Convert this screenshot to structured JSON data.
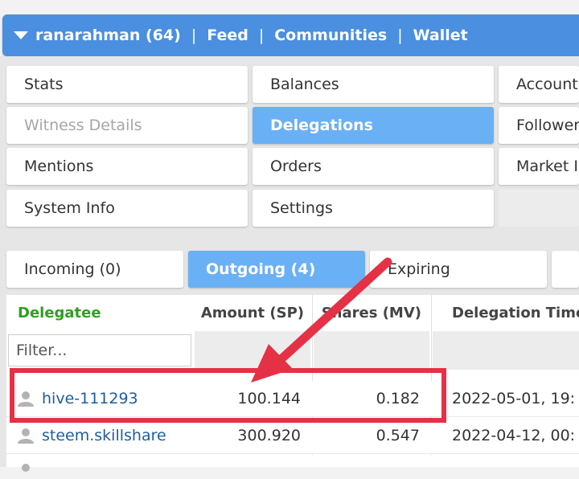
{
  "topbar": {
    "user": "ranarahman (64)",
    "separator": "|",
    "links": [
      "Feed",
      "Communities",
      "Wallet"
    ]
  },
  "menu": {
    "items": [
      "Stats",
      "Balances",
      "Account",
      "Witness Details",
      "Delegations",
      "Followers",
      "Mentions",
      "Orders",
      "Market I",
      "System Info",
      "Settings"
    ],
    "active": "Delegations",
    "disabled": "Witness Details"
  },
  "tabs": {
    "items": [
      "Incoming (0)",
      "Outgoing (4)",
      "Expiring"
    ],
    "active": "Outgoing (4)"
  },
  "table": {
    "headers": [
      "Delegatee",
      "Amount (SP)",
      "Shares (MV)",
      "Delegation Time"
    ],
    "filter_placeholder": "Filter...",
    "rows": [
      {
        "delegatee": "hive-111293",
        "amount": "100.144",
        "shares": "0.182",
        "time": "2022-05-01, 19:"
      },
      {
        "delegatee": "steem.skillshare",
        "amount": "300.920",
        "shares": "0.547",
        "time": "2022-04-12, 00:"
      }
    ]
  },
  "colors": {
    "topbar": "#4a8fe0",
    "active_tile": "#6ab0f5",
    "delegatee_header": "#2f9e22",
    "link": "#1d5d9e",
    "annotation": "#e53145"
  },
  "icons": {
    "topbar_caret": "triangle-down-icon",
    "row_user": "user-icon"
  }
}
